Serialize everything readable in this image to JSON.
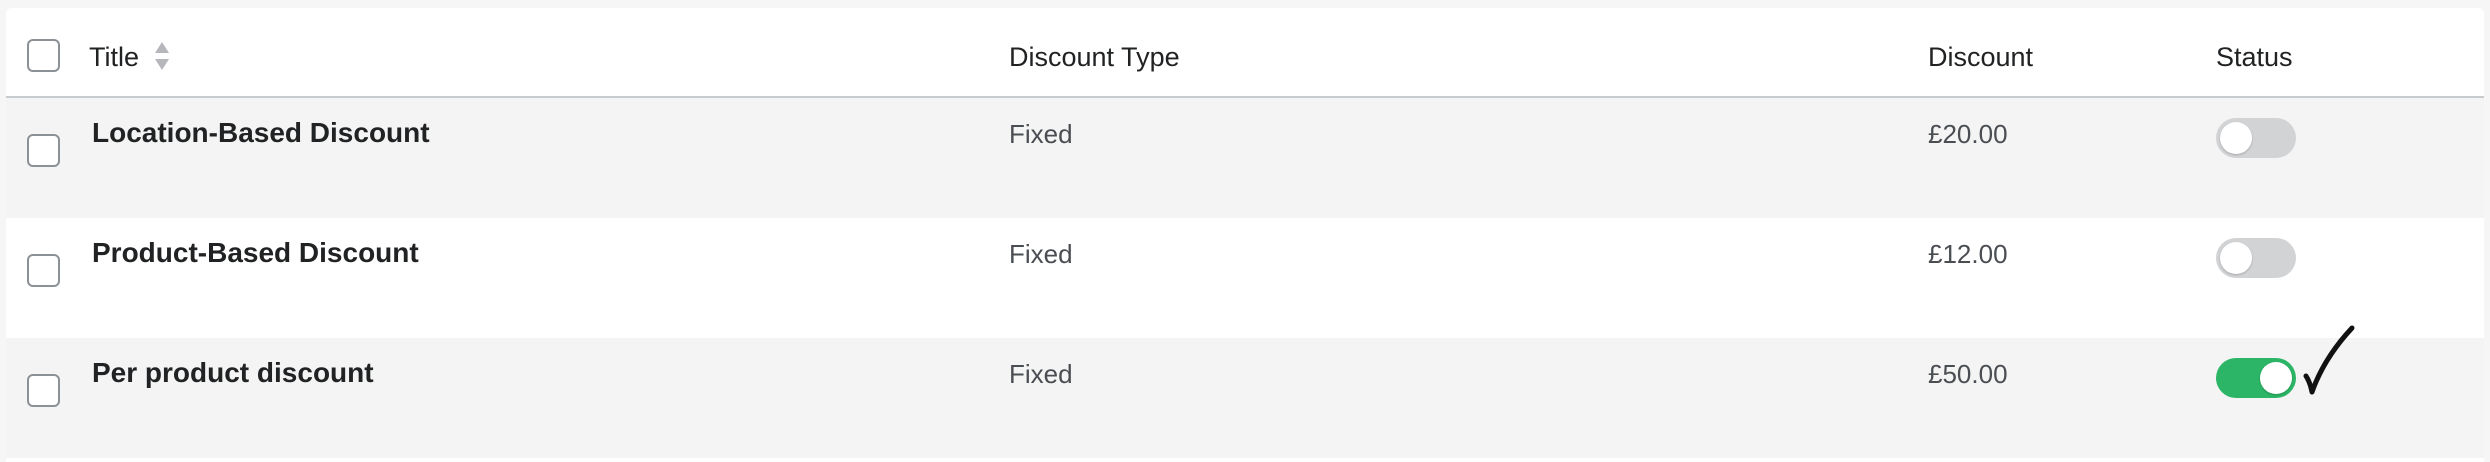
{
  "table": {
    "headers": {
      "title": "Title",
      "discount_type": "Discount Type",
      "discount": "Discount",
      "status": "Status"
    },
    "rows": [
      {
        "title": "Location-Based Discount",
        "discount_type": "Fixed",
        "discount": "£20.00",
        "status_enabled": false
      },
      {
        "title": "Product-Based Discount",
        "discount_type": "Fixed",
        "discount": "£12.00",
        "status_enabled": false
      },
      {
        "title": "Per product discount",
        "discount_type": "Fixed",
        "discount": "£50.00",
        "status_enabled": true
      }
    ]
  },
  "colors": {
    "toggle_on": "#2cb566",
    "toggle_off": "#d2d3d5",
    "row_shaded": "#f4f4f4"
  },
  "icons": {
    "sort": "sort-icon",
    "annotation": "handwritten-check-mark-icon"
  }
}
